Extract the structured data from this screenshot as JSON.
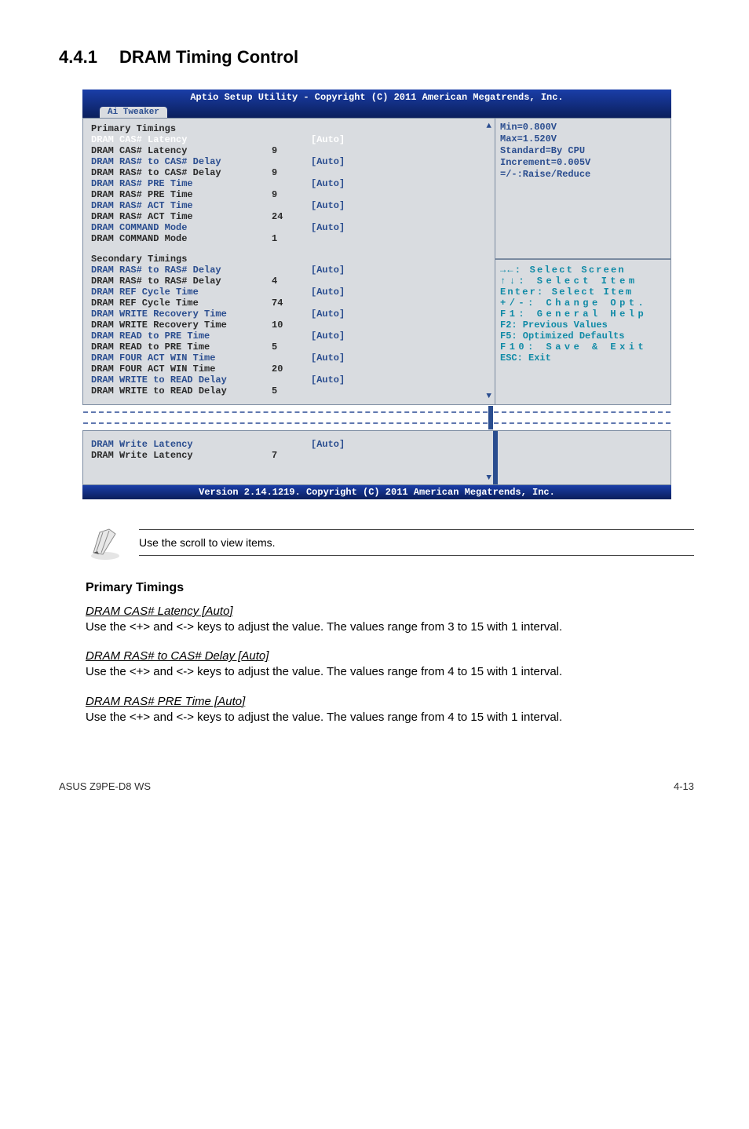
{
  "heading": {
    "number": "4.4.1",
    "title": "DRAM Timing Control"
  },
  "bios": {
    "headerBar": "Aptio Setup Utility - Copyright (C) 2011 American Megatrends, Inc.",
    "tab": "Ai Tweaker",
    "footerBar": "Version 2.14.1219. Copyright (C) 2011 American Megatrends, Inc.",
    "sections": {
      "primaryTitle": "Primary Timings",
      "secondaryTitle": "Secondary Timings"
    },
    "primary": [
      {
        "label": "DRAM CAS# Latency",
        "auto": "[Auto]",
        "val": "",
        "labelClass": "c-white",
        "autoClass": "c-white"
      },
      {
        "label": "DRAM CAS# Latency",
        "auto": "",
        "val": "9",
        "labelClass": "c-black"
      },
      {
        "label": "DRAM RAS# to CAS# Delay",
        "auto": "[Auto]",
        "val": "",
        "labelClass": "c-blue",
        "autoClass": "c-blue"
      },
      {
        "label": "DRAM RAS# to CAS# Delay",
        "auto": "",
        "val": "9",
        "labelClass": "c-black"
      },
      {
        "label": "DRAM RAS# PRE Time",
        "auto": "[Auto]",
        "val": "",
        "labelClass": "c-blue",
        "autoClass": "c-blue"
      },
      {
        "label": "DRAM RAS# PRE Time",
        "auto": "",
        "val": "9",
        "labelClass": "c-black"
      },
      {
        "label": "DRAM RAS# ACT Time",
        "auto": "[Auto]",
        "val": "",
        "labelClass": "c-blue",
        "autoClass": "c-blue"
      },
      {
        "label": "DRAM RAS# ACT Time",
        "auto": "",
        "val": "24",
        "labelClass": "c-black"
      },
      {
        "label": "DRAM COMMAND Mode",
        "auto": "[Auto]",
        "val": "",
        "labelClass": "c-blue",
        "autoClass": "c-blue"
      },
      {
        "label": "DRAM COMMAND Mode",
        "auto": "",
        "val": "1",
        "labelClass": "c-black"
      }
    ],
    "secondary": [
      {
        "label": "DRAM RAS# to RAS# Delay",
        "auto": "[Auto]",
        "val": "",
        "labelClass": "c-blue",
        "autoClass": "c-blue"
      },
      {
        "label": "DRAM RAS# to RAS# Delay",
        "auto": "",
        "val": "4",
        "labelClass": "c-black"
      },
      {
        "label": "DRAM REF Cycle Time",
        "auto": "[Auto]",
        "val": "",
        "labelClass": "c-blue",
        "autoClass": "c-blue"
      },
      {
        "label": "DRAM REF Cycle Time",
        "auto": "",
        "val": "74",
        "labelClass": "c-black"
      },
      {
        "label": "DRAM WRITE Recovery Time",
        "auto": "[Auto]",
        "val": "",
        "labelClass": "c-blue",
        "autoClass": "c-blue"
      },
      {
        "label": "DRAM WRITE Recovery Time",
        "auto": "",
        "val": "10",
        "labelClass": "c-black"
      },
      {
        "label": "DRAM READ to PRE Time",
        "auto": "[Auto]",
        "val": "",
        "labelClass": "c-blue",
        "autoClass": "c-blue"
      },
      {
        "label": "DRAM READ to PRE Time",
        "auto": "",
        "val": "5",
        "labelClass": "c-black"
      },
      {
        "label": "DRAM FOUR ACT WIN Time",
        "auto": "[Auto]",
        "val": "",
        "labelClass": "c-blue",
        "autoClass": "c-blue"
      },
      {
        "label": "DRAM FOUR ACT WIN Time",
        "auto": "",
        "val": "20",
        "labelClass": "c-black"
      },
      {
        "label": "DRAM WRITE to READ Delay",
        "auto": "[Auto]",
        "val": "",
        "labelClass": "c-blue",
        "autoClass": "c-blue"
      },
      {
        "label": "DRAM WRITE to READ Delay",
        "auto": "",
        "val": "5",
        "labelClass": "c-black"
      }
    ],
    "extra": [
      {
        "label": "DRAM Write Latency",
        "auto": "[Auto]",
        "val": "",
        "labelClass": "c-blue",
        "autoClass": "c-blue"
      },
      {
        "label": "DRAM Write Latency",
        "auto": "",
        "val": "7",
        "labelClass": "c-black"
      }
    ],
    "rightInfo": [
      "Min=0.800V",
      "Max=1.520V",
      "Standard=By CPU",
      "Increment=0.005V",
      "=/-:Raise/Reduce"
    ],
    "rightHelp": [
      {
        "text": "→←: Select Screen",
        "class": "wide"
      },
      {
        "text": "↑↓: Select Item",
        "class": "wider"
      },
      {
        "text": "Enter: Select Item",
        "class": "wide"
      },
      {
        "text": "+/-: Change Opt.",
        "class": "wider"
      },
      {
        "text": "F1: General Help",
        "class": "wider"
      },
      {
        "text": "F2: Previous Values",
        "class": ""
      },
      {
        "text": "F5: Optimized Defaults",
        "class": ""
      },
      {
        "text": "F10: Save & Exit",
        "class": "wider"
      },
      {
        "text": "ESC: Exit",
        "class": ""
      }
    ]
  },
  "note": "Use the scroll to view items.",
  "body": {
    "primaryHeading": "Primary Timings",
    "items": [
      {
        "title": "DRAM CAS# Latency [Auto]",
        "desc": "Use the <+> and <-> keys to adjust the value. The values range from 3 to 15 with 1 interval."
      },
      {
        "title": "DRAM RAS# to CAS# Delay [Auto]",
        "desc": "Use the <+> and <-> keys to adjust the value. The values range from 4 to 15 with 1 interval."
      },
      {
        "title": "DRAM RAS# PRE Time [Auto]",
        "desc": "Use the <+> and <-> keys to adjust the value. The values range from 4 to 15 with 1 interval."
      }
    ]
  },
  "footer": {
    "left": "ASUS Z9PE-D8 WS",
    "right": "4-13"
  }
}
